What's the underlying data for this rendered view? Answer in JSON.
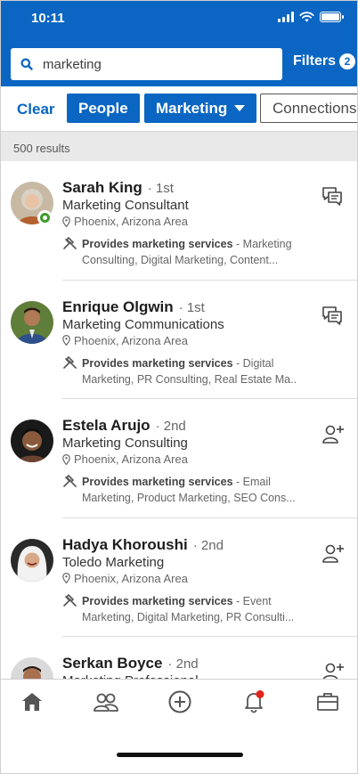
{
  "status_bar": {
    "time": "10:11"
  },
  "search": {
    "value": "marketing",
    "filters_label": "Filters",
    "filters_count": "2"
  },
  "pills": {
    "clear": "Clear",
    "people": "People",
    "marketing": "Marketing",
    "connections": "Connections"
  },
  "results_count": "500 results",
  "colors": {
    "brand": "#0a66c2",
    "online": "#3f9b29",
    "notification": "#e2231a"
  },
  "results": [
    {
      "name": "Sarah King",
      "degree": "· 1st",
      "headline": "Marketing Consultant",
      "location": "Phoenix, Arizona Area",
      "services_label": "Provides marketing services",
      "services_rest_1": " - Marketing",
      "services_line2": "Consulting, Digital Marketing, Content...",
      "action": "message-icon",
      "online": true
    },
    {
      "name": "Enrique Olgwin",
      "degree": "· 1st",
      "headline": "Marketing Communications",
      "location": "Phoenix, Arizona Area",
      "services_label": "Provides marketing services",
      "services_rest_1": " - Digital",
      "services_line2": "Marketing, PR Consulting, Real Estate Ma...",
      "action": "message-icon",
      "online": false
    },
    {
      "name": "Estela Arujo",
      "degree": "· 2nd",
      "headline": "Marketing Consulting",
      "location": "Phoenix, Arizona Area",
      "services_label": "Provides marketing services",
      "services_rest_1": " - Email",
      "services_line2": "Marketing, Product Marketing, SEO Cons...",
      "action": "add-connection-icon",
      "online": false
    },
    {
      "name": "Hadya Khoroushi",
      "degree": "· 2nd",
      "headline": "Toledo Marketing",
      "location": "Phoenix, Arizona Area",
      "services_label": "Provides marketing services",
      "services_rest_1": " - Event",
      "services_line2": "Marketing, Digital Marketing, PR Consulti...",
      "action": "add-connection-icon",
      "online": false
    },
    {
      "name": "Serkan Boyce",
      "degree": "· 2nd",
      "headline": "Marketing Professional",
      "action": "add-connection-icon",
      "online": false
    }
  ],
  "bottom_nav": [
    "home-icon",
    "my-network-icon",
    "post-icon",
    "notifications-icon",
    "jobs-icon"
  ]
}
